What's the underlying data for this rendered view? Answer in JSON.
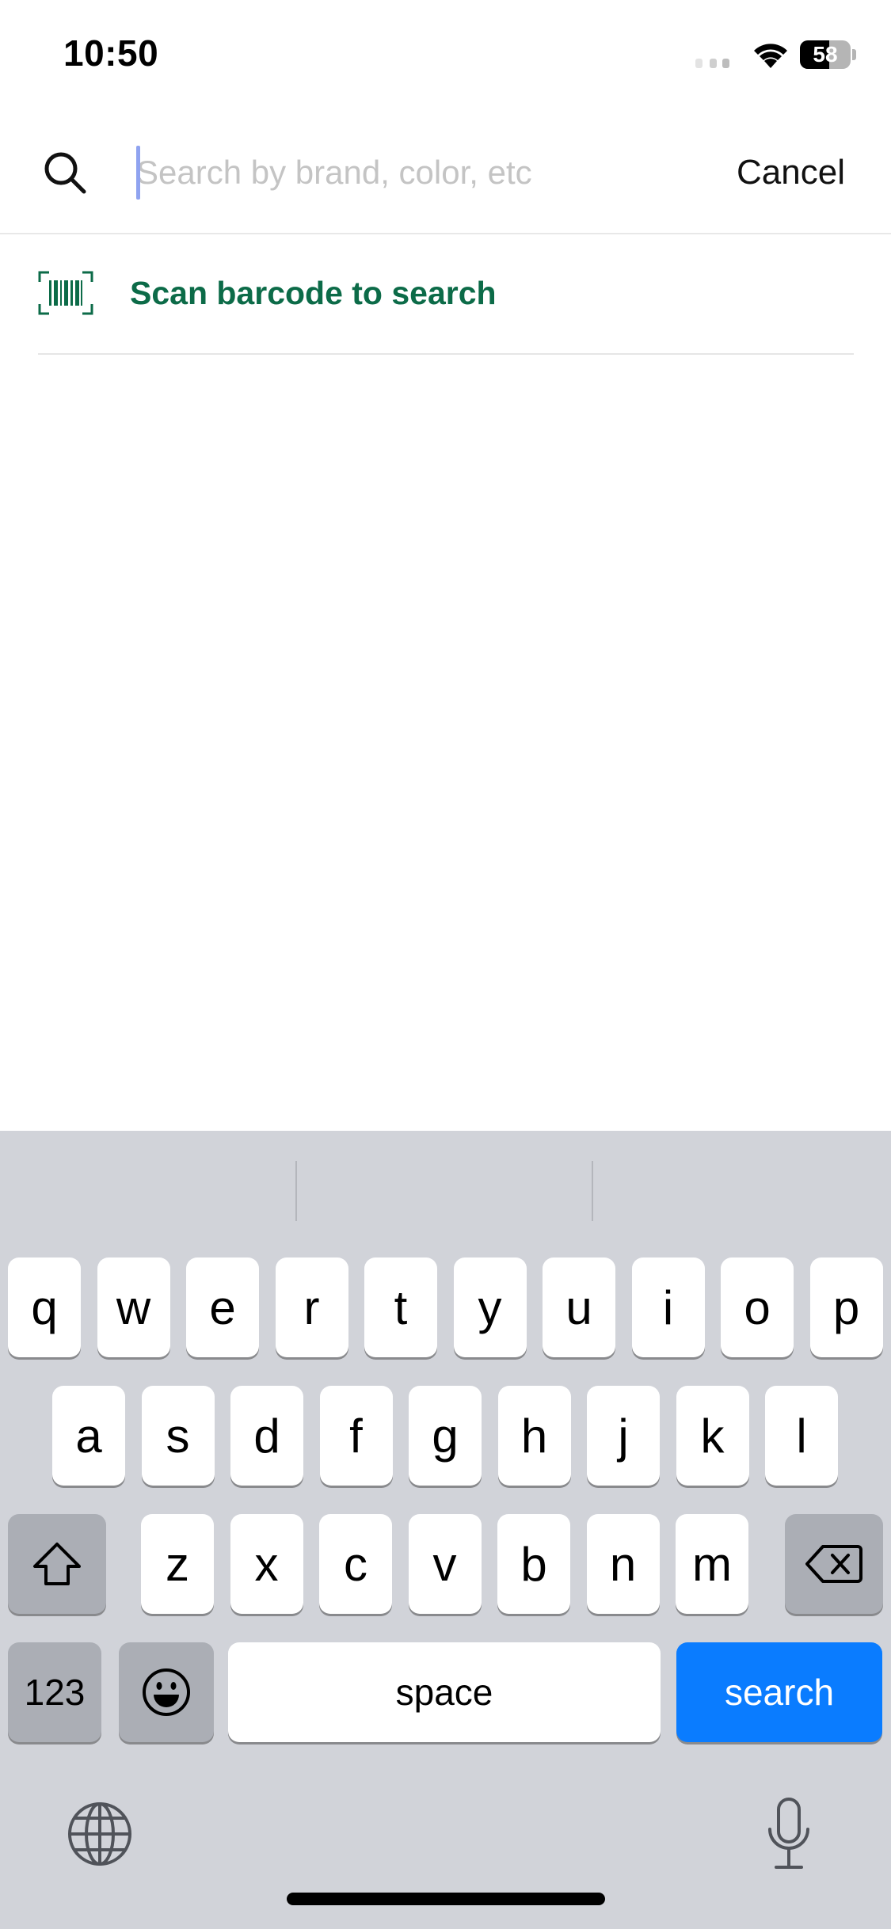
{
  "status_bar": {
    "time": "10:50",
    "battery_level": "58",
    "battery_fraction": 0.58
  },
  "search": {
    "placeholder": "Search by brand, color, etc",
    "value": "",
    "cancel_label": "Cancel",
    "icon": "search-icon"
  },
  "scan": {
    "label": "Scan barcode to search",
    "icon": "barcode-icon",
    "color": "#0c6b48"
  },
  "keyboard": {
    "row1": [
      "q",
      "w",
      "e",
      "r",
      "t",
      "y",
      "u",
      "i",
      "o",
      "p"
    ],
    "row2": [
      "a",
      "s",
      "d",
      "f",
      "g",
      "h",
      "j",
      "k",
      "l"
    ],
    "row3": [
      "z",
      "x",
      "c",
      "v",
      "b",
      "n",
      "m"
    ],
    "numbers_label": "123",
    "space_label": "space",
    "return_label": "search",
    "shift_icon": "shift-icon",
    "delete_icon": "backspace-icon",
    "emoji_icon": "emoji-icon",
    "globe_icon": "globe-icon",
    "mic_icon": "microphone-icon",
    "return_color": "#0a7cff"
  }
}
